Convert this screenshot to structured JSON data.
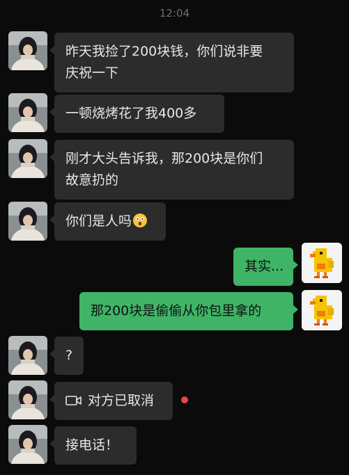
{
  "chat": {
    "timestamp": "12:04",
    "messages": [
      {
        "side": "left",
        "lines": [
          "昨天我捡了200块钱，你们说非要",
          "庆祝一下"
        ]
      },
      {
        "side": "left",
        "lines": [
          "一顿烧烤花了我400多"
        ]
      },
      {
        "side": "left",
        "lines": [
          "刚才大头告诉我，那200块是你们",
          "故意扔的"
        ]
      },
      {
        "side": "left",
        "lines": [
          "你们是人吗"
        ],
        "emoji": "astonished-face-emoji"
      },
      {
        "side": "right",
        "lines": [
          "其实..."
        ]
      },
      {
        "side": "right",
        "lines": [
          "那200块是偷偷从你包里拿的"
        ]
      },
      {
        "side": "left",
        "lines": [
          "?"
        ]
      },
      {
        "side": "left",
        "lines": [
          "对方已取消"
        ],
        "icon": "video-call-icon",
        "unread_dot": true
      },
      {
        "side": "left",
        "lines": [
          "接电话！"
        ]
      }
    ]
  },
  "colors": {
    "background": "#0b0b0b",
    "incoming_bubble": "#2c2c2c",
    "outgoing_bubble": "#3fb466",
    "unread_dot": "#f0434a"
  }
}
